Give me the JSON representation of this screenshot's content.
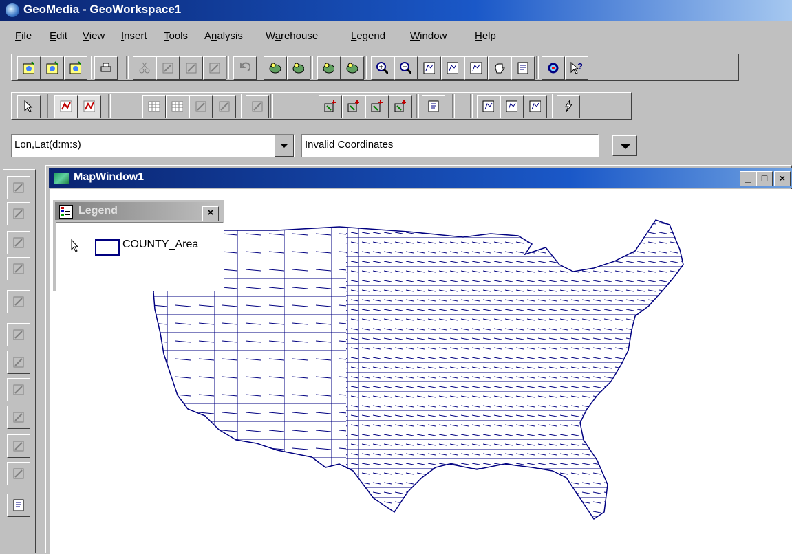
{
  "app": {
    "title": "GeoMedia - GeoWorkspace1"
  },
  "menu": [
    {
      "label": "File",
      "u": "F",
      "rest": "ile"
    },
    {
      "label": "Edit",
      "u": "E",
      "rest": "dit"
    },
    {
      "label": "View",
      "u": "V",
      "rest": "iew"
    },
    {
      "label": "Insert",
      "u": "I",
      "rest": "nsert"
    },
    {
      "label": "Tools",
      "u": "T",
      "rest": "ools"
    },
    {
      "label": "Analysis",
      "pre": "A",
      "u": "n",
      "rest": "alysis"
    },
    {
      "label": "Warehouse",
      "pre": "W",
      "u": "a",
      "rest": "rehouse"
    },
    {
      "label": "Legend",
      "u": "L",
      "rest": "egend"
    },
    {
      "label": "Window",
      "u": "W",
      "rest": "indow"
    },
    {
      "label": "Help",
      "u": "H",
      "rest": "elp"
    }
  ],
  "toolbar1": {
    "icons": [
      "new-workspace-icon",
      "open-workspace-icon",
      "save-workspace-icon",
      "print-icon",
      "cut-icon",
      "copy-icon",
      "paste-icon",
      "copy-image-icon",
      "undo-icon",
      "add-legend-entry-icon",
      "style-icon",
      "spatial-filter-icon",
      "feature-info-icon",
      "zoom-in-icon",
      "zoom-out-icon",
      "fit-all-icon",
      "fit-legend-icon",
      "fit-selected-icon",
      "pan-icon",
      "refresh-icon",
      "magnifier-icon",
      "whats-this-help-icon"
    ]
  },
  "toolbar2": {
    "icons": [
      "select-tool-icon",
      "select-set-icon",
      "select-set-2-icon",
      "table-icon",
      "table-2-icon",
      "attribute-icon",
      "insert-record-icon",
      "label-icon",
      "insert-feature-icon",
      "insert-point-icon",
      "insert-area-icon",
      "insert-line-icon",
      "properties-icon",
      "map-window-icon",
      "fence-icon",
      "polygon-select-icon",
      "lightning-icon"
    ]
  },
  "coords": {
    "system": "Lon,Lat(d:m:s)",
    "readout": "Invalid Coordinates"
  },
  "left_tools": [
    "insert-north-arrow-icon",
    "insert-label-icon",
    "insert-text-icon",
    "insert-h-icon",
    "continue-geometry-icon",
    "edit-geometry-icon",
    "split-icon",
    "smooth-icon",
    "delete-geometry-icon",
    "rotate-icon",
    "trim-icon",
    "properties-tool-icon"
  ],
  "mapwindow": {
    "title": "MapWindow1",
    "buttons": [
      "_",
      "□",
      "×"
    ]
  },
  "legend": {
    "title": "Legend",
    "close": "×",
    "entries": [
      {
        "label": "COUNTY_Area",
        "color": "#000080"
      }
    ]
  },
  "map": {
    "stroke": "#000080",
    "background": "#ffffff"
  }
}
